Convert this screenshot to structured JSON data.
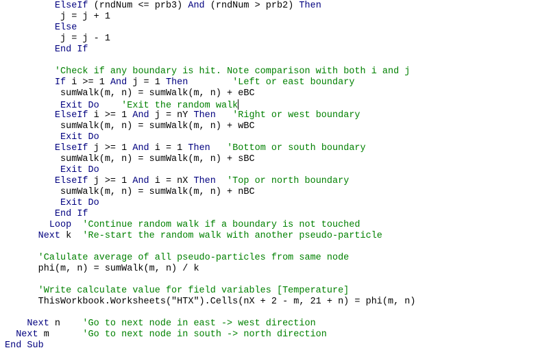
{
  "editor": {
    "lines": [
      {
        "indent": 9,
        "segments": [
          {
            "t": "kw",
            "v": "ElseIf"
          },
          {
            "t": "tx",
            "v": " (rndNum <= prb3) "
          },
          {
            "t": "kw",
            "v": "And"
          },
          {
            "t": "tx",
            "v": " (rndNum > prb2) "
          },
          {
            "t": "kw",
            "v": "Then"
          }
        ]
      },
      {
        "indent": 10,
        "segments": [
          {
            "t": "tx",
            "v": "j = j + 1"
          }
        ]
      },
      {
        "indent": 9,
        "segments": [
          {
            "t": "kw",
            "v": "Else"
          }
        ]
      },
      {
        "indent": 10,
        "segments": [
          {
            "t": "tx",
            "v": "j = j - 1"
          }
        ]
      },
      {
        "indent": 9,
        "segments": [
          {
            "t": "kw",
            "v": "End If"
          }
        ]
      },
      {
        "indent": 0,
        "segments": []
      },
      {
        "indent": 9,
        "segments": [
          {
            "t": "cm",
            "v": "'Check if any boundary is hit. Note comparison with both i and j"
          }
        ]
      },
      {
        "indent": 9,
        "segments": [
          {
            "t": "kw",
            "v": "If"
          },
          {
            "t": "tx",
            "v": " i >= 1 "
          },
          {
            "t": "kw",
            "v": "And"
          },
          {
            "t": "tx",
            "v": " j = 1 "
          },
          {
            "t": "kw",
            "v": "Then"
          },
          {
            "t": "tx",
            "v": "        "
          },
          {
            "t": "cm",
            "v": "'Left or east boundary"
          }
        ]
      },
      {
        "indent": 10,
        "segments": [
          {
            "t": "tx",
            "v": "sumWalk(m, n) = sumWalk(m, n) + eBC"
          }
        ]
      },
      {
        "indent": 10,
        "segments": [
          {
            "t": "kw",
            "v": "Exit Do"
          },
          {
            "t": "tx",
            "v": "    "
          },
          {
            "t": "cm",
            "v": "'Exit the random walk"
          }
        ],
        "caret": true
      },
      {
        "indent": 9,
        "segments": [
          {
            "t": "kw",
            "v": "ElseIf"
          },
          {
            "t": "tx",
            "v": " i >= 1 "
          },
          {
            "t": "kw",
            "v": "And"
          },
          {
            "t": "tx",
            "v": " j = nY "
          },
          {
            "t": "kw",
            "v": "Then"
          },
          {
            "t": "tx",
            "v": "   "
          },
          {
            "t": "cm",
            "v": "'Right or west boundary"
          }
        ]
      },
      {
        "indent": 10,
        "segments": [
          {
            "t": "tx",
            "v": "sumWalk(m, n) = sumWalk(m, n) + wBC"
          }
        ]
      },
      {
        "indent": 10,
        "segments": [
          {
            "t": "kw",
            "v": "Exit Do"
          }
        ]
      },
      {
        "indent": 9,
        "segments": [
          {
            "t": "kw",
            "v": "ElseIf"
          },
          {
            "t": "tx",
            "v": " j >= 1 "
          },
          {
            "t": "kw",
            "v": "And"
          },
          {
            "t": "tx",
            "v": " i = 1 "
          },
          {
            "t": "kw",
            "v": "Then"
          },
          {
            "t": "tx",
            "v": "   "
          },
          {
            "t": "cm",
            "v": "'Bottom or south boundary"
          }
        ]
      },
      {
        "indent": 10,
        "segments": [
          {
            "t": "tx",
            "v": "sumWalk(m, n) = sumWalk(m, n) + sBC"
          }
        ]
      },
      {
        "indent": 10,
        "segments": [
          {
            "t": "kw",
            "v": "Exit Do"
          }
        ]
      },
      {
        "indent": 9,
        "segments": [
          {
            "t": "kw",
            "v": "ElseIf"
          },
          {
            "t": "tx",
            "v": " j >= 1 "
          },
          {
            "t": "kw",
            "v": "And"
          },
          {
            "t": "tx",
            "v": " i = nX "
          },
          {
            "t": "kw",
            "v": "Then"
          },
          {
            "t": "tx",
            "v": "  "
          },
          {
            "t": "cm",
            "v": "'Top or north boundary"
          }
        ]
      },
      {
        "indent": 10,
        "segments": [
          {
            "t": "tx",
            "v": "sumWalk(m, n) = sumWalk(m, n) + nBC"
          }
        ]
      },
      {
        "indent": 10,
        "segments": [
          {
            "t": "kw",
            "v": "Exit Do"
          }
        ]
      },
      {
        "indent": 9,
        "segments": [
          {
            "t": "kw",
            "v": "End If"
          }
        ]
      },
      {
        "indent": 8,
        "segments": [
          {
            "t": "kw",
            "v": "Loop"
          },
          {
            "t": "tx",
            "v": "  "
          },
          {
            "t": "cm",
            "v": "'Continue random walk if a boundary is not touched"
          }
        ]
      },
      {
        "indent": 6,
        "segments": [
          {
            "t": "kw",
            "v": "Next"
          },
          {
            "t": "tx",
            "v": " k  "
          },
          {
            "t": "cm",
            "v": "'Re-start the random walk with another pseudo-particle"
          }
        ]
      },
      {
        "indent": 0,
        "segments": []
      },
      {
        "indent": 6,
        "segments": [
          {
            "t": "cm",
            "v": "'Calulate average of all pseudo-particles from same node"
          }
        ]
      },
      {
        "indent": 6,
        "segments": [
          {
            "t": "tx",
            "v": "phi(m, n) = sumWalk(m, n) / k"
          }
        ]
      },
      {
        "indent": 0,
        "segments": []
      },
      {
        "indent": 6,
        "segments": [
          {
            "t": "cm",
            "v": "'Write calculate value for field variables [Temperature]"
          }
        ]
      },
      {
        "indent": 6,
        "segments": [
          {
            "t": "tx",
            "v": "ThisWorkbook.Worksheets(\"HTX\").Cells(nX + 2 - m, 21 + n) = phi(m, n)"
          }
        ]
      },
      {
        "indent": 0,
        "segments": []
      },
      {
        "indent": 4,
        "segments": [
          {
            "t": "kw",
            "v": "Next"
          },
          {
            "t": "tx",
            "v": " n    "
          },
          {
            "t": "cm",
            "v": "'Go to next node in east -> west direction"
          }
        ]
      },
      {
        "indent": 2,
        "segments": [
          {
            "t": "kw",
            "v": "Next"
          },
          {
            "t": "tx",
            "v": " m      "
          },
          {
            "t": "cm",
            "v": "'Go to next node in south -> north direction"
          }
        ]
      },
      {
        "indent": 0,
        "segments": [
          {
            "t": "kw",
            "v": "End Sub"
          }
        ]
      }
    ]
  }
}
